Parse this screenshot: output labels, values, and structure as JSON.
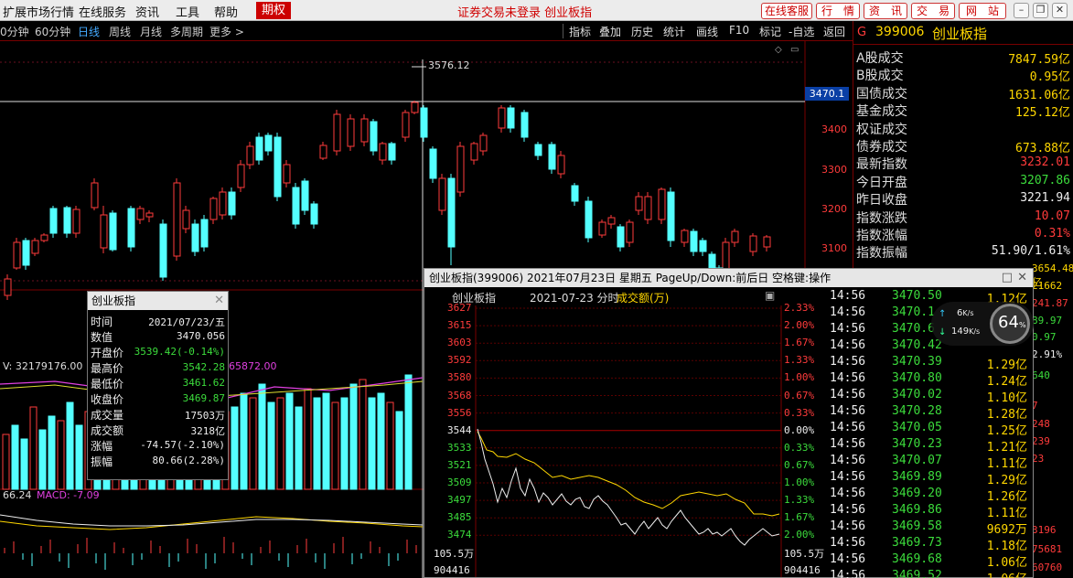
{
  "menu": {
    "items": [
      "扩展市场行情",
      "在线服务",
      "资讯",
      "工具",
      "帮助"
    ],
    "active": "期权",
    "login_notice": "证券交易未登录",
    "index_name": "创业板指",
    "buttons": [
      "在线客服",
      "行　情",
      "资　讯",
      "交　易",
      "网　站"
    ]
  },
  "toolbar": {
    "periods": [
      "0分钟",
      "60分钟",
      "日线",
      "周线",
      "月线",
      "多周期",
      "更多 >"
    ],
    "active_period": "日线",
    "tools": [
      "指标",
      "叠加",
      "历史",
      "统计",
      "画线",
      "F10",
      "标记",
      "-自选",
      "返回"
    ]
  },
  "chart": {
    "high_label": "3576.12",
    "axis_current": "3470.1",
    "y_ticks": [
      "3400",
      "3300",
      "3200",
      "3100"
    ],
    "volume_label": "V: 32179176.00",
    "volume_label_2": "65872.00",
    "macd_label_value": "66.24",
    "macd_label": "MACD: -7.09",
    "candles_up": [
      [
        5,
        255,
        283,
        260,
        278
      ],
      [
        15,
        215,
        250,
        220,
        248
      ],
      [
        35,
        215,
        235,
        218,
        232
      ],
      [
        45,
        210,
        220,
        212,
        218
      ],
      [
        80,
        180,
        215,
        184,
        210
      ],
      [
        100,
        150,
        185,
        155,
        182
      ],
      [
        110,
        180,
        232,
        190,
        226
      ],
      [
        150,
        180,
        200,
        183,
        195
      ],
      [
        160,
        185,
        198,
        188,
        192
      ],
      [
        190,
        150,
        240,
        155,
        235
      ],
      [
        200,
        180,
        210,
        185,
        205
      ],
      [
        230,
        170,
        200,
        172,
        195
      ],
      [
        240,
        160,
        195,
        165,
        190
      ],
      [
        260,
        130,
        165,
        135,
        160
      ],
      [
        270,
        110,
        140,
        115,
        135
      ],
      [
        310,
        130,
        160,
        135,
        155
      ],
      [
        350,
        110,
        130,
        114,
        128
      ],
      [
        365,
        75,
        125,
        80,
        120
      ],
      [
        380,
        80,
        120,
        85,
        115
      ],
      [
        395,
        80,
        115,
        85,
        110
      ],
      [
        415,
        110,
        135,
        112,
        130
      ],
      [
        440,
        75,
        110,
        78,
        105
      ],
      [
        450,
        65,
        80,
        67,
        78
      ],
      [
        480,
        145,
        190,
        150,
        185
      ],
      [
        500,
        110,
        170,
        115,
        165
      ],
      [
        515,
        110,
        135,
        112,
        130
      ],
      [
        525,
        100,
        125,
        103,
        120
      ],
      [
        545,
        70,
        100,
        73,
        95
      ],
      [
        610,
        120,
        150,
        125,
        145
      ],
      [
        655,
        195,
        215,
        198,
        212
      ],
      [
        665,
        190,
        205,
        193,
        200
      ],
      [
        685,
        195,
        225,
        198,
        220
      ],
      [
        695,
        165,
        190,
        170,
        185
      ],
      [
        705,
        165,
        200,
        170,
        195
      ],
      [
        720,
        160,
        200,
        162,
        195
      ],
      [
        745,
        205,
        225,
        207,
        220
      ],
      [
        790,
        215,
        275,
        220,
        270
      ],
      [
        800,
        205,
        225,
        208,
        220
      ],
      [
        820,
        210,
        235,
        213,
        230
      ],
      [
        835,
        212,
        230,
        214,
        225
      ]
    ],
    "candles_down": [
      [
        25,
        215,
        250,
        218,
        245
      ],
      [
        55,
        180,
        215,
        183,
        210
      ],
      [
        70,
        180,
        215,
        182,
        210
      ],
      [
        120,
        185,
        230,
        188,
        228
      ],
      [
        140,
        180,
        230,
        183,
        225
      ],
      [
        175,
        195,
        262,
        200,
        258
      ],
      [
        210,
        195,
        235,
        200,
        230
      ],
      [
        220,
        190,
        230,
        195,
        225
      ],
      [
        250,
        160,
        195,
        165,
        190
      ],
      [
        280,
        100,
        135,
        105,
        130
      ],
      [
        290,
        100,
        125,
        103,
        120
      ],
      [
        300,
        100,
        175,
        105,
        170
      ],
      [
        320,
        155,
        205,
        160,
        200
      ],
      [
        330,
        150,
        190,
        153,
        185
      ],
      [
        340,
        175,
        205,
        178,
        200
      ],
      [
        405,
        85,
        125,
        88,
        120
      ],
      [
        425,
        110,
        135,
        112,
        130
      ],
      [
        460,
        70,
        110,
        73,
        105
      ],
      [
        470,
        115,
        155,
        118,
        150
      ],
      [
        490,
        145,
        245,
        150,
        225
      ],
      [
        555,
        70,
        100,
        73,
        95
      ],
      [
        570,
        75,
        110,
        78,
        105
      ],
      [
        585,
        110,
        130,
        113,
        125
      ],
      [
        600,
        110,
        145,
        113,
        140
      ],
      [
        625,
        155,
        180,
        158,
        175
      ],
      [
        640,
        170,
        220,
        175,
        215
      ],
      [
        675,
        200,
        230,
        203,
        225
      ],
      [
        730,
        160,
        225,
        165,
        218
      ],
      [
        755,
        205,
        235,
        208,
        230
      ],
      [
        765,
        215,
        235,
        218,
        230
      ],
      [
        775,
        230,
        255,
        233,
        250
      ],
      [
        783,
        245,
        270,
        248,
        262
      ]
    ]
  },
  "info_box": {
    "title": "创业板指",
    "rows": [
      {
        "label": "时间",
        "value": "2021/07/23/五",
        "color": "#eee"
      },
      {
        "label": "数值",
        "value": "3470.056",
        "color": "#eee"
      },
      {
        "label": "开盘价",
        "value": "3539.42(-0.14%)",
        "color": "#3cdc3c"
      },
      {
        "label": "最高价",
        "value": "3542.28",
        "color": "#3cdc3c"
      },
      {
        "label": "最低价",
        "value": "3461.62",
        "color": "#3cdc3c"
      },
      {
        "label": "收盘价",
        "value": "3469.87",
        "color": "#3cdc3c"
      },
      {
        "label": "成交量",
        "value": "17503万",
        "color": "#eee"
      },
      {
        "label": "成交额",
        "value": "3218亿",
        "color": "#eee"
      },
      {
        "label": "涨幅",
        "value": "-74.57(-2.10%)",
        "color": "#eee"
      },
      {
        "label": "振幅",
        "value": "80.66(2.28%)",
        "color": "#eee"
      }
    ]
  },
  "right_panel": {
    "code": "399006",
    "name": "创业板指",
    "rows": [
      {
        "label": "A股成交",
        "value": "7847.59亿",
        "color": "#ffd700"
      },
      {
        "label": "B股成交",
        "value": "0.95亿",
        "color": "#ffd700"
      },
      {
        "label": "国债成交",
        "value": "1631.06亿",
        "color": "#ffd700"
      },
      {
        "label": "基金成交",
        "value": "125.12亿",
        "color": "#ffd700"
      },
      {
        "label": "权证成交",
        "value": "",
        "color": "#ffd700"
      },
      {
        "label": "债券成交",
        "value": "673.88亿",
        "color": "#ffd700"
      },
      {
        "label": "最新指数",
        "value": "3232.01",
        "color": "#ff3b3b"
      },
      {
        "label": "今日开盘",
        "value": "3207.86",
        "color": "#3cdc3c"
      },
      {
        "label": "昨日收盘",
        "value": "3221.94",
        "color": "#eee"
      },
      {
        "label": "指数涨跌",
        "value": "10.07",
        "color": "#ff3b3b"
      },
      {
        "label": "指数涨幅",
        "value": "0.31%",
        "color": "#ff3b3b"
      },
      {
        "label": "指数振幅",
        "value": "51.90/1.61%",
        "color": "#eee"
      }
    ]
  },
  "popup": {
    "title": "创业板指(399006)  2021年07月23日 星期五  PageUp/Down:前后日 空格键:操作",
    "subtitle_name": "创业板指",
    "subtitle_date": "2021-07-23 分时",
    "subtitle_vol": "成交额(万)",
    "left_axis": [
      "3627",
      "3615",
      "3603",
      "3592",
      "3580",
      "3568",
      "3556",
      "3544",
      "3533",
      "3521",
      "3509",
      "3497",
      "3485",
      "3474",
      "105.5万",
      "904416"
    ],
    "right_axis": [
      "2.33%",
      "2.00%",
      "1.67%",
      "1.33%",
      "1.00%",
      "0.67%",
      "0.33%",
      "0.00%",
      "0.33%",
      "0.67%",
      "1.00%",
      "1.33%",
      "1.67%",
      "2.00%",
      "105.5万",
      "904416"
    ]
  },
  "ticks": [
    {
      "time": "14:56",
      "price": "3470.50",
      "vol": "1.12亿"
    },
    {
      "time": "14:56",
      "price": "3470.1",
      "vol": ""
    },
    {
      "time": "14:56",
      "price": "3470.6",
      "vol": ""
    },
    {
      "time": "14:56",
      "price": "3470.42",
      "vol": ""
    },
    {
      "time": "14:56",
      "price": "3470.39",
      "vol": "1.29亿"
    },
    {
      "time": "14:56",
      "price": "3470.80",
      "vol": "1.24亿"
    },
    {
      "time": "14:56",
      "price": "3470.02",
      "vol": "1.10亿"
    },
    {
      "time": "14:56",
      "price": "3470.28",
      "vol": "1.28亿"
    },
    {
      "time": "14:56",
      "price": "3470.05",
      "vol": "1.25亿"
    },
    {
      "time": "14:56",
      "price": "3470.23",
      "vol": "1.21亿"
    },
    {
      "time": "14:56",
      "price": "3470.07",
      "vol": "1.11亿"
    },
    {
      "time": "14:56",
      "price": "3469.89",
      "vol": "1.29亿"
    },
    {
      "time": "14:56",
      "price": "3469.20",
      "vol": "1.26亿"
    },
    {
      "time": "14:56",
      "price": "3469.86",
      "vol": "1.11亿"
    },
    {
      "time": "14:56",
      "price": "3469.58",
      "vol": "9692万"
    },
    {
      "time": "14:56",
      "price": "3469.73",
      "vol": "1.18亿"
    },
    {
      "time": "14:56",
      "price": "3469.68",
      "vol": "1.06亿"
    },
    {
      "time": "14:56",
      "price": "3469.52",
      "vol": "1.06亿"
    }
  ],
  "right_peek": [
    {
      "text": "3654.48亿",
      "color": "#ffd700"
    },
    {
      "text": "21662",
      "color": "#ffd700"
    },
    {
      "text": "241.87",
      "color": "#ff3b3b"
    },
    {
      "text": "89.97",
      "color": "#3cdc3c"
    },
    {
      "text": "0.97",
      "color": "#3cdc3c"
    },
    {
      "text": "2.91%",
      "color": "#eee"
    },
    {
      "text": "640",
      "color": "#3cdc3c"
    },
    {
      "text": "7",
      "color": "#ff3b3b"
    },
    {
      "text": "248",
      "color": "#ff3b3b"
    },
    {
      "text": "239",
      "color": "#ff3b3b"
    },
    {
      "text": "23",
      "color": "#ff3b3b"
    },
    {
      "text": "3196",
      "color": "#ff3b3b"
    },
    {
      "text": "75681",
      "color": "#ff3b3b"
    },
    {
      "text": "60760",
      "color": "#ff3b3b"
    }
  ],
  "speed_widget": {
    "up": "6",
    "down": "149",
    "unit": "K/s",
    "percent": "64",
    "percent_unit": "%"
  }
}
